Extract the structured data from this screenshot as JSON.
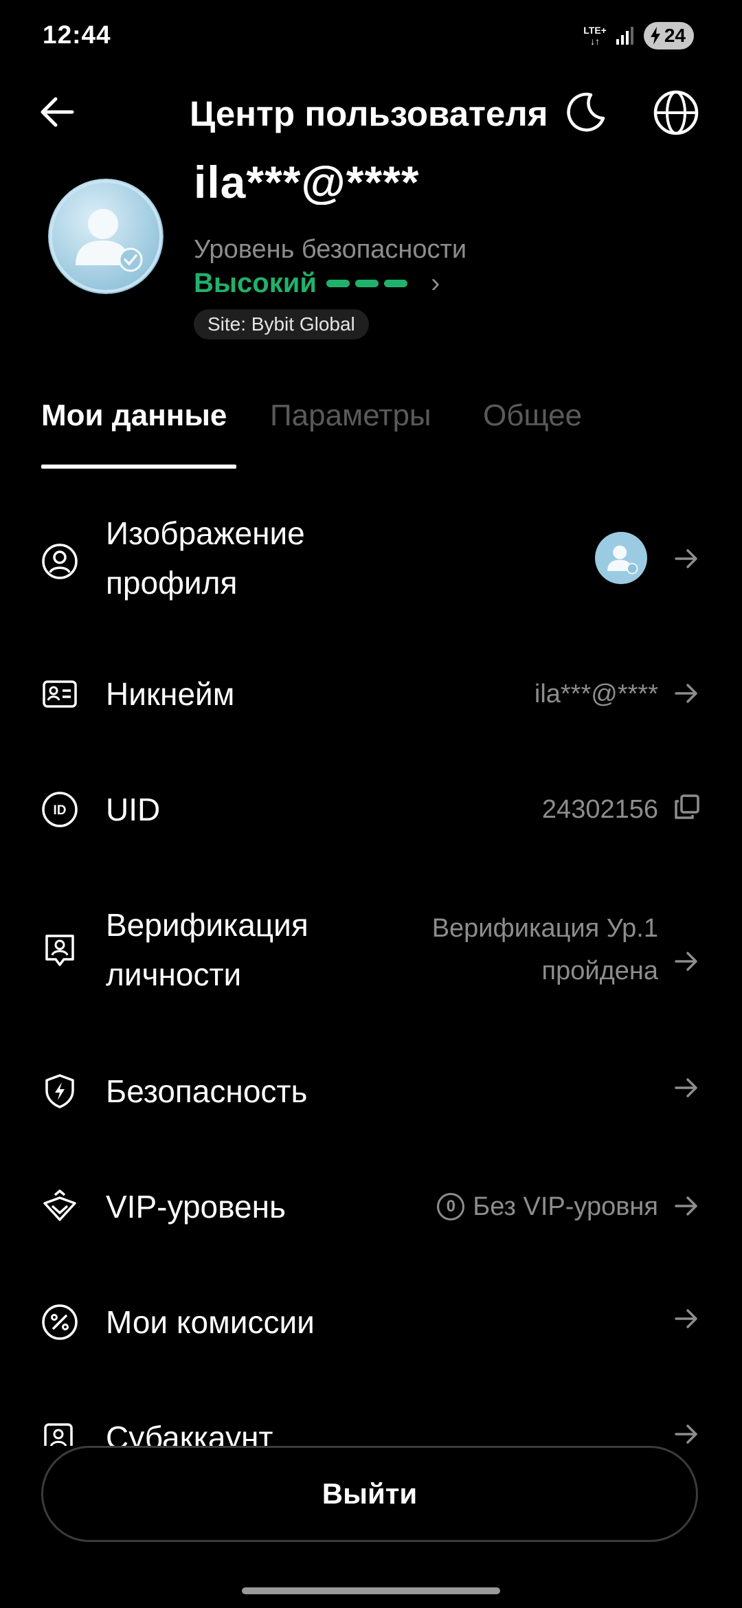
{
  "status_bar": {
    "time": "12:44",
    "network_top": "LTE+",
    "network_bottom": "↓↑",
    "battery": "24"
  },
  "header": {
    "title": "Центр пользователя",
    "back_icon": "back-arrow-icon",
    "theme_icon": "moon-icon",
    "language_icon": "globe-icon"
  },
  "profile": {
    "name": "ila***@****",
    "security_label": "Уровень безопасности",
    "security_value": "Высокий",
    "site_badge": "Site: Bybit Global",
    "accent": "#20b26c"
  },
  "tabs": [
    {
      "label": "Мои данные",
      "active": true
    },
    {
      "label": "Параметры",
      "active": false
    },
    {
      "label": "Общее",
      "active": false
    }
  ],
  "rows": {
    "profile_image": {
      "label_1": "Изображение",
      "label_2": "профиля",
      "icon": "user-circle-icon"
    },
    "nickname": {
      "label": "Никнейм",
      "value": "ila***@****",
      "icon": "id-card-icon"
    },
    "uid": {
      "label": "UID",
      "value": "24302156",
      "icon": "id-badge-icon"
    },
    "verification": {
      "label_1": "Верификация",
      "label_2": "личности",
      "value_1": "Верификация Ур.1",
      "value_2": "пройдена",
      "icon": "person-frame-icon"
    },
    "security": {
      "label": "Безопасность",
      "icon": "shield-bolt-icon"
    },
    "vip": {
      "label": "VIP-уровень",
      "badge": "0",
      "value": "Без VIP-уровня",
      "icon": "crown-icon"
    },
    "fees": {
      "label": "Мои комиссии",
      "icon": "percent-icon"
    },
    "subaccount": {
      "label": "Субаккаунт",
      "icon": "subaccount-icon"
    }
  },
  "logout_label": "Выйти"
}
